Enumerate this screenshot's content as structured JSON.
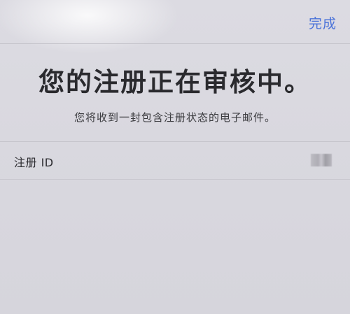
{
  "nav": {
    "done_label": "完成"
  },
  "header": {
    "title": "您的注册正在审核中。",
    "subtitle": "您将收到一封包含注册状态的电子邮件。"
  },
  "details": {
    "registration_id_label": "注册 ID"
  }
}
